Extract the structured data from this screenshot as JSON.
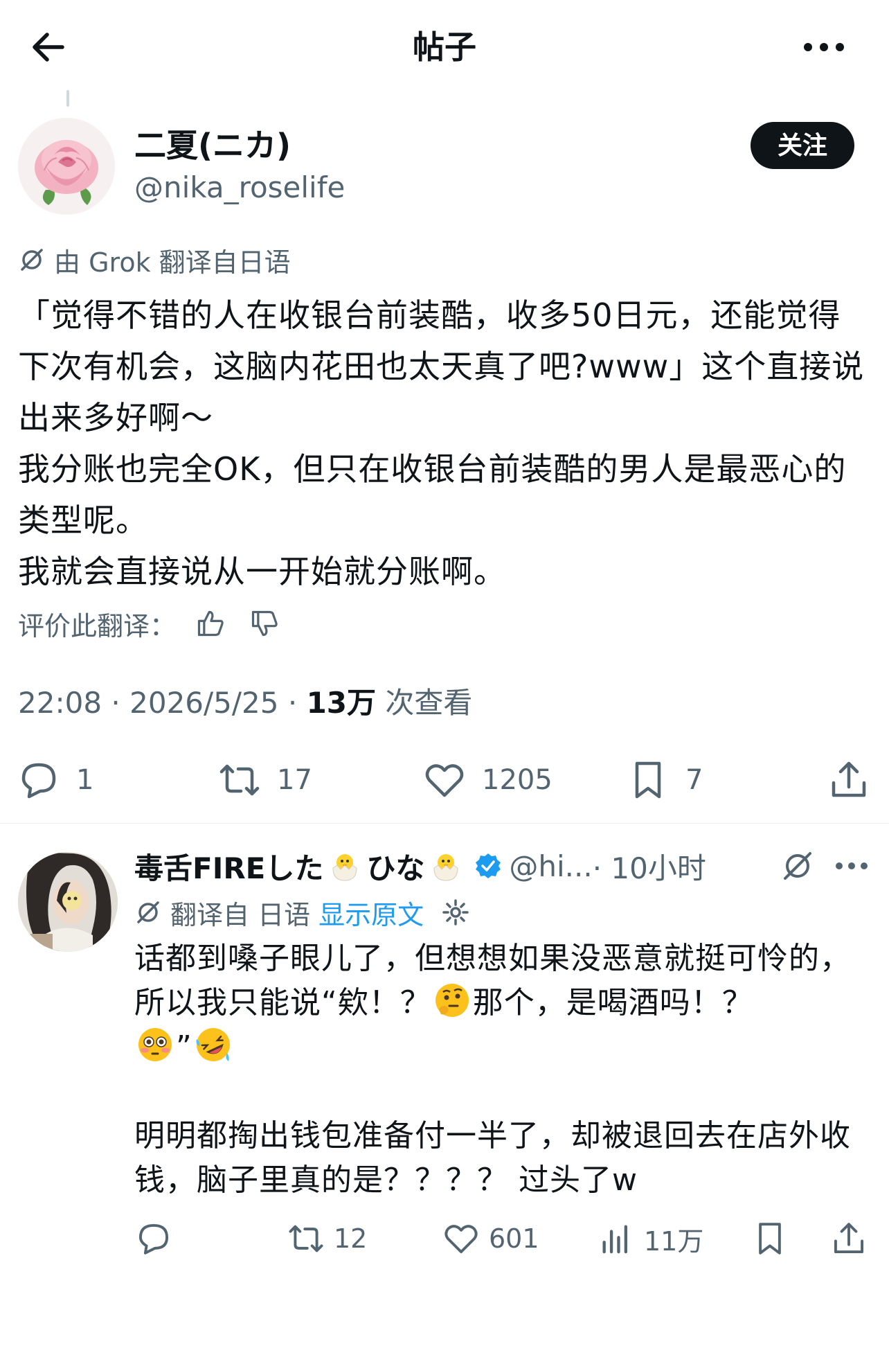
{
  "header": {
    "title": "帖子",
    "back_icon": "arrow-left-icon",
    "more_icon": "more-horizontal-icon"
  },
  "post": {
    "author": {
      "display_name": "二夏(ニカ)",
      "handle": "@nika_roselife",
      "avatar": "rose-avatar"
    },
    "follow_label": "关注",
    "translation_note": "由 Grok 翻译自日语",
    "text": "「觉得不错的人在收银台前装酷，收多50日元，还能觉得下次有机会，这脑内花田也太天真了吧?www」这个直接说出来多好啊～\n我分账也完全OK，但只在收银台前装酷的男人是最恶心的类型呢。\n我就会直接说从一开始就分账啊。",
    "rate_label": "评价此翻译：",
    "meta": {
      "time": "22:08",
      "separator": "·",
      "date": "2026/5/25",
      "views_count": "13万",
      "views_label": "次查看"
    },
    "actions": {
      "replies": "1",
      "reposts": "17",
      "likes": "1205",
      "bookmarks": "7"
    }
  },
  "reply": {
    "display_name_part1": "毒舌FIREした",
    "display_name_part2": "ひな",
    "handle": "@hi...",
    "time": "· 10小时",
    "translation_note": "翻译自 日语",
    "show_original": "显示原文",
    "text_line1": "话都到嗓子眼儿了，但想想如果没恶意就挺可怜的，所以我只能说“欸！？",
    "text_line2": "那个，是喝酒吗！？",
    "text_line3": "”",
    "text_para2": "明明都掏出钱包准备付一半了，却被退回去在店外收钱，脑子里真的是？？？？ 过头了w",
    "actions": {
      "replies": "",
      "reposts": "12",
      "likes": "601",
      "views": "11万"
    }
  },
  "colors": {
    "text": "#0f1419",
    "secondary": "#536471",
    "accent": "#1d9bf0",
    "divider": "#eff3f4"
  }
}
